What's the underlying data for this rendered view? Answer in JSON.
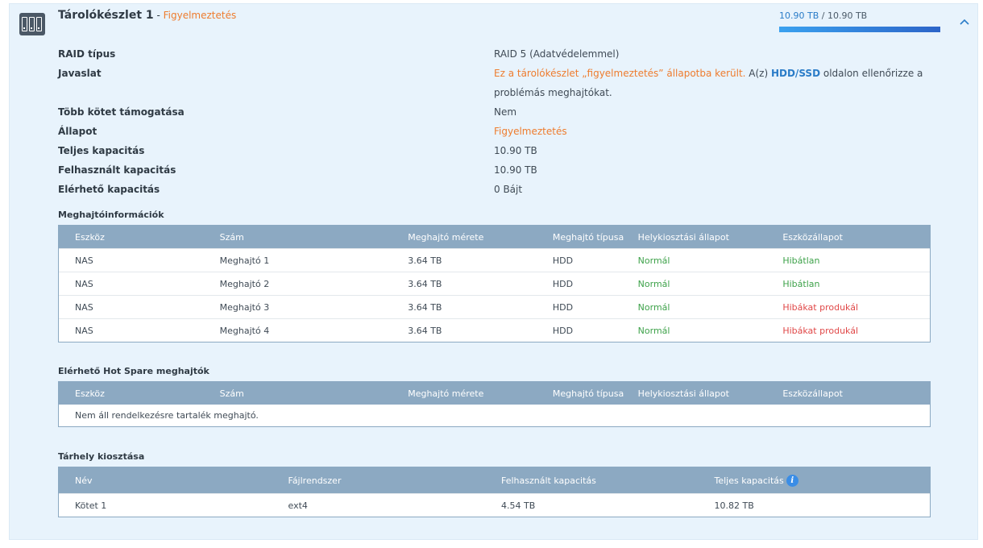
{
  "pool": {
    "title": "Tárolókészlet 1",
    "separator": " - ",
    "status": "Figyelmeztetés",
    "used": "10.90 TB",
    "slash": " / ",
    "total": "10.90 TB",
    "usage_fraction": 1.0,
    "collapse_icon": "chevron-up-icon"
  },
  "props": {
    "raid_label": "RAID típus",
    "raid_value": "RAID 5 (Adatvédelemmel)",
    "advice_label": "Javaslat",
    "advice_orange": "Ez a tárolókészlet „figyelmeztetés” állapotba került.",
    "advice_mid": " A(z) ",
    "advice_link": "HDD/SSD",
    "advice_rest_line1": " oldalon ellenőrizze a",
    "advice_rest_line2": "problémás meghajtókat.",
    "multi_label": "Több kötet támogatása",
    "multi_value": "Nem",
    "state_label": "Állapot",
    "state_value": "Figyelmeztetés",
    "total_label": "Teljes kapacitás",
    "total_value": "10.90 TB",
    "used_label": "Felhasznált kapacitás",
    "used_value": "10.90 TB",
    "avail_label": "Elérhető kapacitás",
    "avail_value": "0 Bájt"
  },
  "drives": {
    "title": "Meghajtóinformációk",
    "headers": [
      "Eszköz",
      "Szám",
      "Meghajtó mérete",
      "Meghajtó típusa",
      "Helykiosztási állapot",
      "Eszközállapot"
    ],
    "rows": [
      {
        "device": "NAS",
        "num": "Meghajtó 1",
        "size": "3.64 TB",
        "type": "HDD",
        "alloc": "Normál",
        "health": "Hibátlan"
      },
      {
        "device": "NAS",
        "num": "Meghajtó 2",
        "size": "3.64 TB",
        "type": "HDD",
        "alloc": "Normál",
        "health": "Hibátlan"
      },
      {
        "device": "NAS",
        "num": "Meghajtó 3",
        "size": "3.64 TB",
        "type": "HDD",
        "alloc": "Normál",
        "health": "Hibákat produkál"
      },
      {
        "device": "NAS",
        "num": "Meghajtó 4",
        "size": "3.64 TB",
        "type": "HDD",
        "alloc": "Normál",
        "health": "Hibákat produkál"
      }
    ]
  },
  "spares": {
    "title": "Elérhető Hot Spare meghajtók",
    "headers": [
      "Eszköz",
      "Szám",
      "Meghajtó mérete",
      "Meghajtó típusa",
      "Helykiosztási állapot",
      "Eszközállapot"
    ],
    "empty": "Nem áll rendelkezésre tartalék meghajtó."
  },
  "volumes": {
    "title": "Tárhely kiosztása",
    "headers": [
      "Név",
      "Fájlrendszer",
      "Felhasznált kapacitás",
      "Teljes kapacitás"
    ],
    "rows": [
      {
        "name": "Kötet 1",
        "fs": "ext4",
        "used": "4.54 TB",
        "total": "10.82 TB"
      }
    ],
    "info_icon": "info-icon"
  },
  "colors": {
    "warning": "#ee7c2e",
    "ok": "#3ea24a",
    "error": "#e04848",
    "link": "#2a7cc8",
    "header_bg": "#8ca9c2",
    "panel_bg": "#e8f3fc"
  }
}
